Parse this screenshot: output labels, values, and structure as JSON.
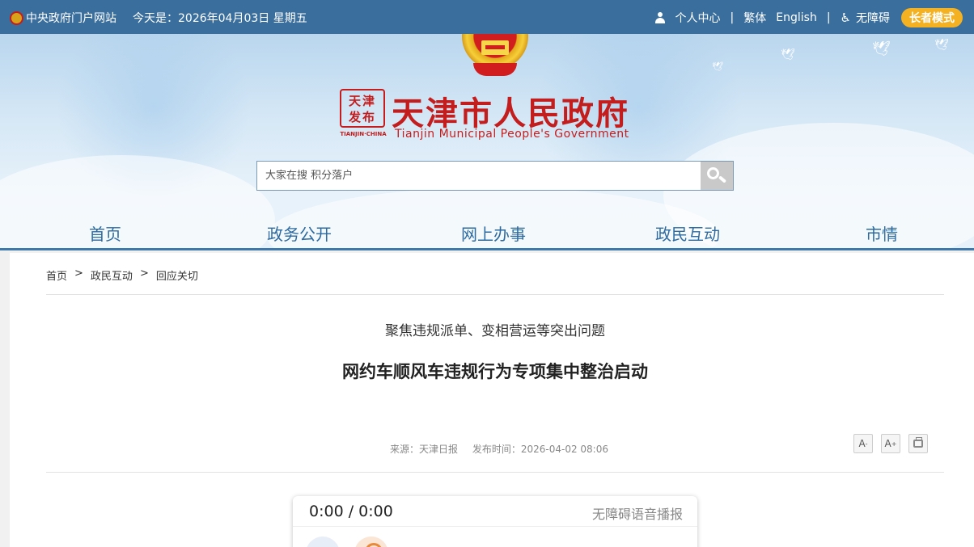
{
  "topbar": {
    "gov_portal": "中央政府门户网站",
    "date_text": "今天是：2026年04月03日 星期五",
    "personal_center": "个人中心",
    "traditional": "繁体",
    "english": "English",
    "accessibility": "无障碍",
    "elder_mode": "长者模式",
    "separator": "|"
  },
  "header": {
    "seal_text_line1": "天津",
    "seal_text_line2": "发布",
    "seal_caption": "TIANJIN·CHINA",
    "title_cn": "天津市人民政府",
    "title_en": "Tianjin Municipal People's Government"
  },
  "search": {
    "placeholder": "大家在搜 积分落户"
  },
  "nav": {
    "items": [
      {
        "label": "首页"
      },
      {
        "label": "政务公开"
      },
      {
        "label": "网上办事"
      },
      {
        "label": "政民互动"
      },
      {
        "label": "市情"
      }
    ]
  },
  "breadcrumb": {
    "items": [
      "首页",
      "政民互动",
      "回应关切"
    ],
    "separator": ">"
  },
  "article": {
    "subtitle": "聚焦违规派单、变相营运等突出问题",
    "title": "网约车顺风车违规行为专项集中整治启动",
    "source": "来源：天津日报",
    "published": "发布时间：2026-04-02 08:06"
  },
  "tools": {
    "font_decrease": "A",
    "font_decrease_mark": "-",
    "font_increase": "A",
    "font_increase_mark": "+"
  },
  "player": {
    "time": "0:00 / 0:00",
    "label": "无障碍语音播报"
  },
  "colors": {
    "topbar": "#3a6e9c",
    "nav_text": "#2d6aa0",
    "brand_red": "#c41d1d",
    "elder_button": "#f4b122"
  }
}
